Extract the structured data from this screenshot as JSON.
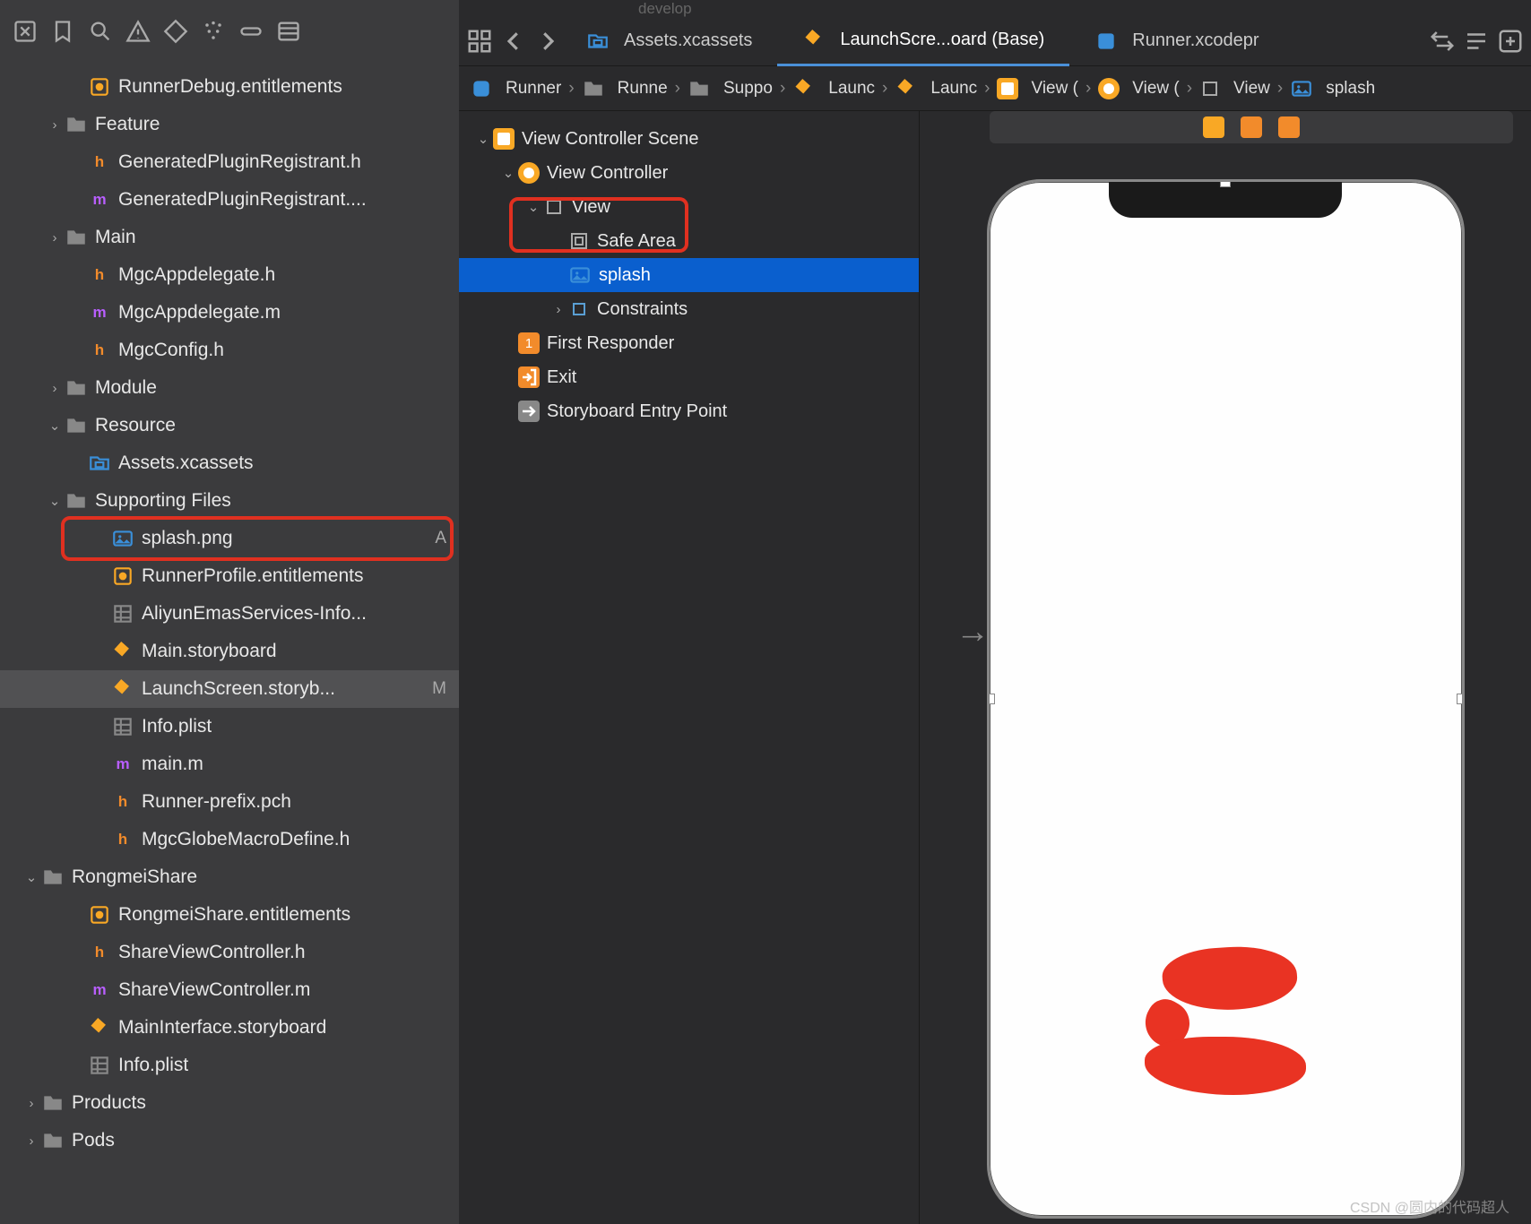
{
  "topbar_faint": "develop",
  "toolbar_icons": [
    "square-x",
    "bookmark",
    "search",
    "warning",
    "diamond",
    "spray",
    "pill",
    "list"
  ],
  "tabs": {
    "nav_icons": [
      "grid",
      "back",
      "forward"
    ],
    "items": [
      {
        "icon": "asset",
        "label": "Assets.xcassets"
      },
      {
        "icon": "storyboard",
        "label": "LaunchScre...oard (Base)",
        "active": true
      },
      {
        "icon": "proj",
        "label": "Runner.xcodepr"
      }
    ],
    "right_icons": [
      "swap",
      "lines",
      "plus-box"
    ]
  },
  "breadcrumb": [
    {
      "icon": "app",
      "label": "Runner"
    },
    {
      "icon": "folder",
      "label": "Runne"
    },
    {
      "icon": "folder",
      "label": "Suppo"
    },
    {
      "icon": "sb",
      "label": "Launc"
    },
    {
      "icon": "sb",
      "label": "Launc"
    },
    {
      "icon": "scene",
      "label": "View ("
    },
    {
      "icon": "vc",
      "label": "View ("
    },
    {
      "icon": "view",
      "label": "View"
    },
    {
      "icon": "img",
      "label": "splash"
    }
  ],
  "tree": [
    {
      "d": 2,
      "disc": "",
      "icon": "ent",
      "name": "RunnerDebug.entitlements"
    },
    {
      "d": 1,
      "disc": ">",
      "icon": "folder",
      "name": "Feature"
    },
    {
      "d": 2,
      "disc": "",
      "icon": "h",
      "name": "GeneratedPluginRegistrant.h"
    },
    {
      "d": 2,
      "disc": "",
      "icon": "m",
      "name": "GeneratedPluginRegistrant...."
    },
    {
      "d": 1,
      "disc": ">",
      "icon": "folder",
      "name": "Main"
    },
    {
      "d": 2,
      "disc": "",
      "icon": "h",
      "name": "MgcAppdelegate.h"
    },
    {
      "d": 2,
      "disc": "",
      "icon": "m",
      "name": "MgcAppdelegate.m"
    },
    {
      "d": 2,
      "disc": "",
      "icon": "h",
      "name": "MgcConfig.h"
    },
    {
      "d": 1,
      "disc": ">",
      "icon": "folder",
      "name": "Module"
    },
    {
      "d": 1,
      "disc": "v",
      "icon": "folder",
      "name": "Resource"
    },
    {
      "d": 2,
      "disc": "",
      "icon": "asset",
      "name": "Assets.xcassets"
    },
    {
      "d": 1,
      "disc": "v",
      "icon": "folder",
      "name": "Supporting Files"
    },
    {
      "d": 3,
      "disc": "",
      "icon": "img",
      "name": "splash.png",
      "badge": "A",
      "annot": true
    },
    {
      "d": 3,
      "disc": "",
      "icon": "ent",
      "name": "RunnerProfile.entitlements"
    },
    {
      "d": 3,
      "disc": "",
      "icon": "plist",
      "name": "AliyunEmasServices-Info..."
    },
    {
      "d": 3,
      "disc": "",
      "icon": "sb",
      "name": "Main.storyboard"
    },
    {
      "d": 3,
      "disc": "",
      "icon": "sb",
      "name": "LaunchScreen.storyb...",
      "badge": "M",
      "sel": true
    },
    {
      "d": 3,
      "disc": "",
      "icon": "plist",
      "name": "Info.plist"
    },
    {
      "d": 3,
      "disc": "",
      "icon": "m",
      "name": "main.m"
    },
    {
      "d": 3,
      "disc": "",
      "icon": "h",
      "name": "Runner-prefix.pch"
    },
    {
      "d": 3,
      "disc": "",
      "icon": "h",
      "name": "MgcGlobeMacroDefine.h"
    },
    {
      "d": 0,
      "disc": "v",
      "icon": "folder",
      "name": "RongmeiShare"
    },
    {
      "d": 2,
      "disc": "",
      "icon": "ent",
      "name": "RongmeiShare.entitlements"
    },
    {
      "d": 2,
      "disc": "",
      "icon": "h",
      "name": "ShareViewController.h"
    },
    {
      "d": 2,
      "disc": "",
      "icon": "m",
      "name": "ShareViewController.m"
    },
    {
      "d": 2,
      "disc": "",
      "icon": "sb",
      "name": "MainInterface.storyboard"
    },
    {
      "d": 2,
      "disc": "",
      "icon": "plist",
      "name": "Info.plist"
    },
    {
      "d": 0,
      "disc": ">",
      "icon": "folder",
      "name": "Products"
    },
    {
      "d": 0,
      "disc": ">",
      "icon": "folder",
      "name": "Pods"
    }
  ],
  "outline": [
    {
      "d": 0,
      "disc": "v",
      "icon": "scene",
      "label": "View Controller Scene"
    },
    {
      "d": 1,
      "disc": "v",
      "icon": "vc",
      "label": "View Controller"
    },
    {
      "d": 2,
      "disc": "v",
      "icon": "view",
      "label": "View"
    },
    {
      "d": 3,
      "disc": "",
      "icon": "safe",
      "label": "Safe Area",
      "annot": true
    },
    {
      "d": 3,
      "disc": "",
      "icon": "img",
      "label": "splash",
      "sel": true
    },
    {
      "d": 3,
      "disc": ">",
      "icon": "constr",
      "label": "Constraints"
    },
    {
      "d": 1,
      "disc": "",
      "icon": "first",
      "label": "First Responder"
    },
    {
      "d": 1,
      "disc": "",
      "icon": "exit",
      "label": "Exit"
    },
    {
      "d": 1,
      "disc": "",
      "icon": "entry",
      "label": "Storyboard Entry Point"
    }
  ],
  "ruler_chips": [
    "#f9a825",
    "#f28b2b",
    "#f28b2b"
  ],
  "watermark": "CSDN @圆内的代码超人"
}
